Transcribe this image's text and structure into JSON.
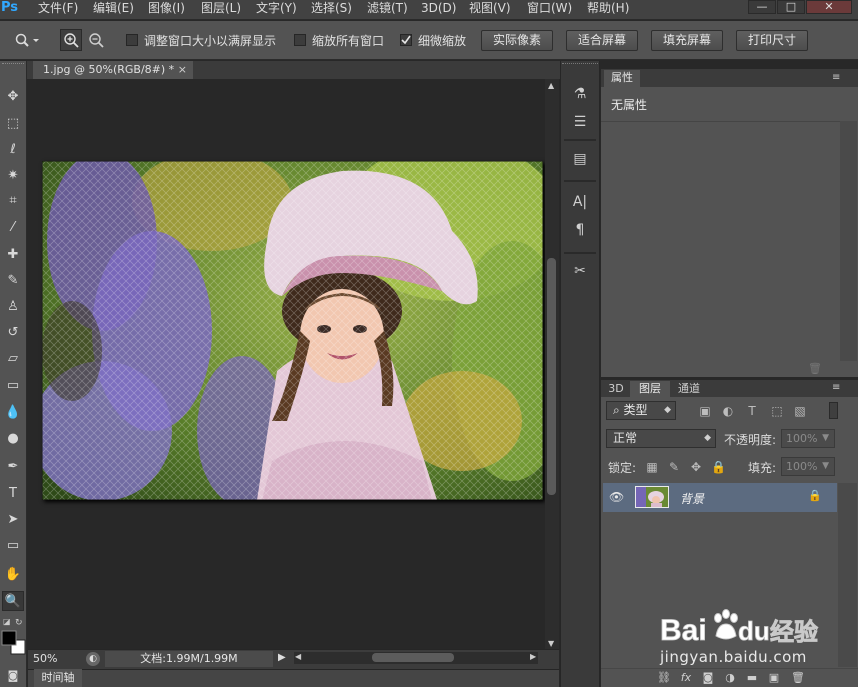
{
  "app": {
    "logo": "Ps"
  },
  "menu": [
    "文件(F)",
    "编辑(E)",
    "图像(I)",
    "图层(L)",
    "文字(Y)",
    "选择(S)",
    "滤镜(T)",
    "3D(D)",
    "视图(V)",
    "窗口(W)",
    "帮助(H)"
  ],
  "window_controls": {
    "minimize": "—",
    "restore": "□",
    "close": "✕"
  },
  "options": {
    "checkbox_resize": {
      "label": "调整窗口大小以满屏显示",
      "checked": false
    },
    "checkbox_zoom_all": {
      "label": "缩放所有窗口",
      "checked": false
    },
    "checkbox_scrubby": {
      "label": "细微缩放",
      "checked": true
    },
    "btn_actual_pixels": "实际像素",
    "btn_fit_screen": "适合屏幕",
    "btn_fill_screen": "填充屏幕",
    "btn_print_size": "打印尺寸"
  },
  "document": {
    "tab_title": "1.jpg @ 50%(RGB/8#) *",
    "close": "×"
  },
  "status": {
    "zoom": "50%",
    "doc_info": "文档:1.99M/1.99M"
  },
  "timeline": {
    "tab": "时间轴"
  },
  "properties": {
    "tab": "属性",
    "body": "无属性"
  },
  "layers": {
    "tabs": [
      "3D",
      "图层",
      "通道"
    ],
    "filter_kind": "类型",
    "blend_mode": "正常",
    "opacity_label": "不透明度:",
    "opacity_value": "100%",
    "lock_label": "锁定:",
    "fill_label": "填充:",
    "fill_value": "100%",
    "layer_name": "背景"
  },
  "watermark": {
    "brand": "Bai",
    "brand_tail": "du",
    "brand_cn": "经验",
    "url": "jingyan.baidu.com"
  },
  "colors": {
    "accent": "#31a8ff",
    "panel": "#535353",
    "selected_layer": "#5c6b80"
  }
}
